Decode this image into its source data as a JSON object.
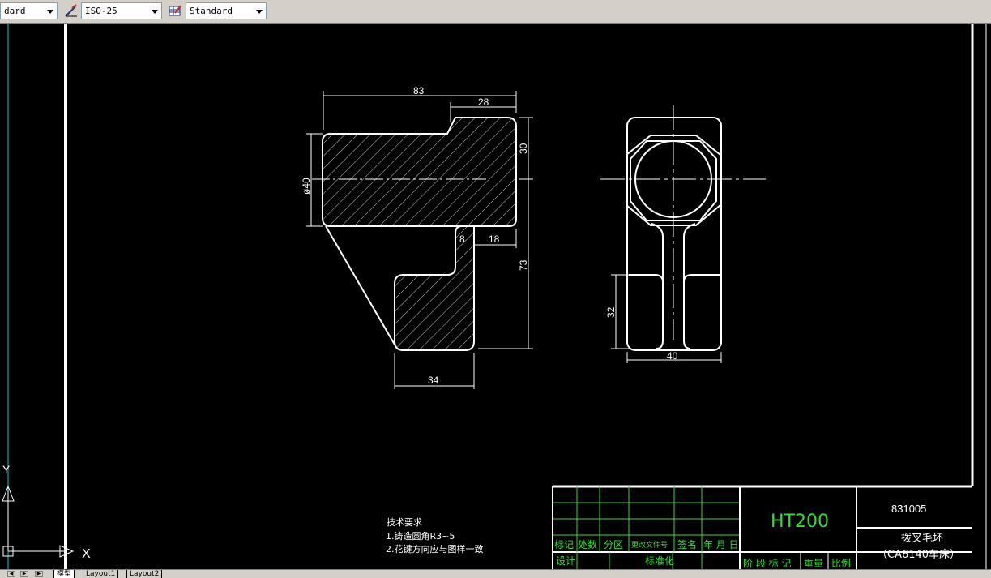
{
  "toolbar": {
    "text_style_value": "dard",
    "dim_style_value": "ISO-25",
    "table_style_value": "Standard",
    "dim_style_icon": "dimension-style-icon",
    "table_style_icon": "table-style-icon"
  },
  "drawing": {
    "front_view": {
      "dim_overall_width": "83",
      "dim_top_boss_width": "28",
      "dim_boss_height": "30",
      "dim_diameter": "ø40",
      "dim_gap": "8",
      "dim_step": "18",
      "dim_total_height": "73",
      "dim_foot_width": "34"
    },
    "side_view": {
      "dim_slot_height": "32",
      "dim_width": "40"
    },
    "tech_requirements": {
      "title": "技术要求",
      "line1": "1.铸造圆角R3~5",
      "line2": "2.花键方向应与图样一致"
    },
    "title_block": {
      "material": "HT200",
      "drawing_number": "831005",
      "part_name": "拨叉毛坯",
      "machine": "（CA6140车床）",
      "label_mark": "标记",
      "label_count": "处数",
      "label_zone": "分区",
      "label_change_doc": "更改文件号",
      "label_sign": "签名",
      "label_date": "年 月 日",
      "label_design": "设计",
      "label_standard": "标准化",
      "label_stage": "阶 段 标 记",
      "label_weight": "重量",
      "label_scale": "比例"
    },
    "ucs": {
      "x_label": "X",
      "y_label": "Y"
    }
  },
  "tabs": [
    {
      "label": "模型"
    },
    {
      "label": "Layout1"
    },
    {
      "label": "Layout2"
    }
  ],
  "colors": {
    "line": "#ffffff",
    "title_block_text": "#33dd33",
    "ucs": "#00cccc",
    "background": "#000000"
  }
}
